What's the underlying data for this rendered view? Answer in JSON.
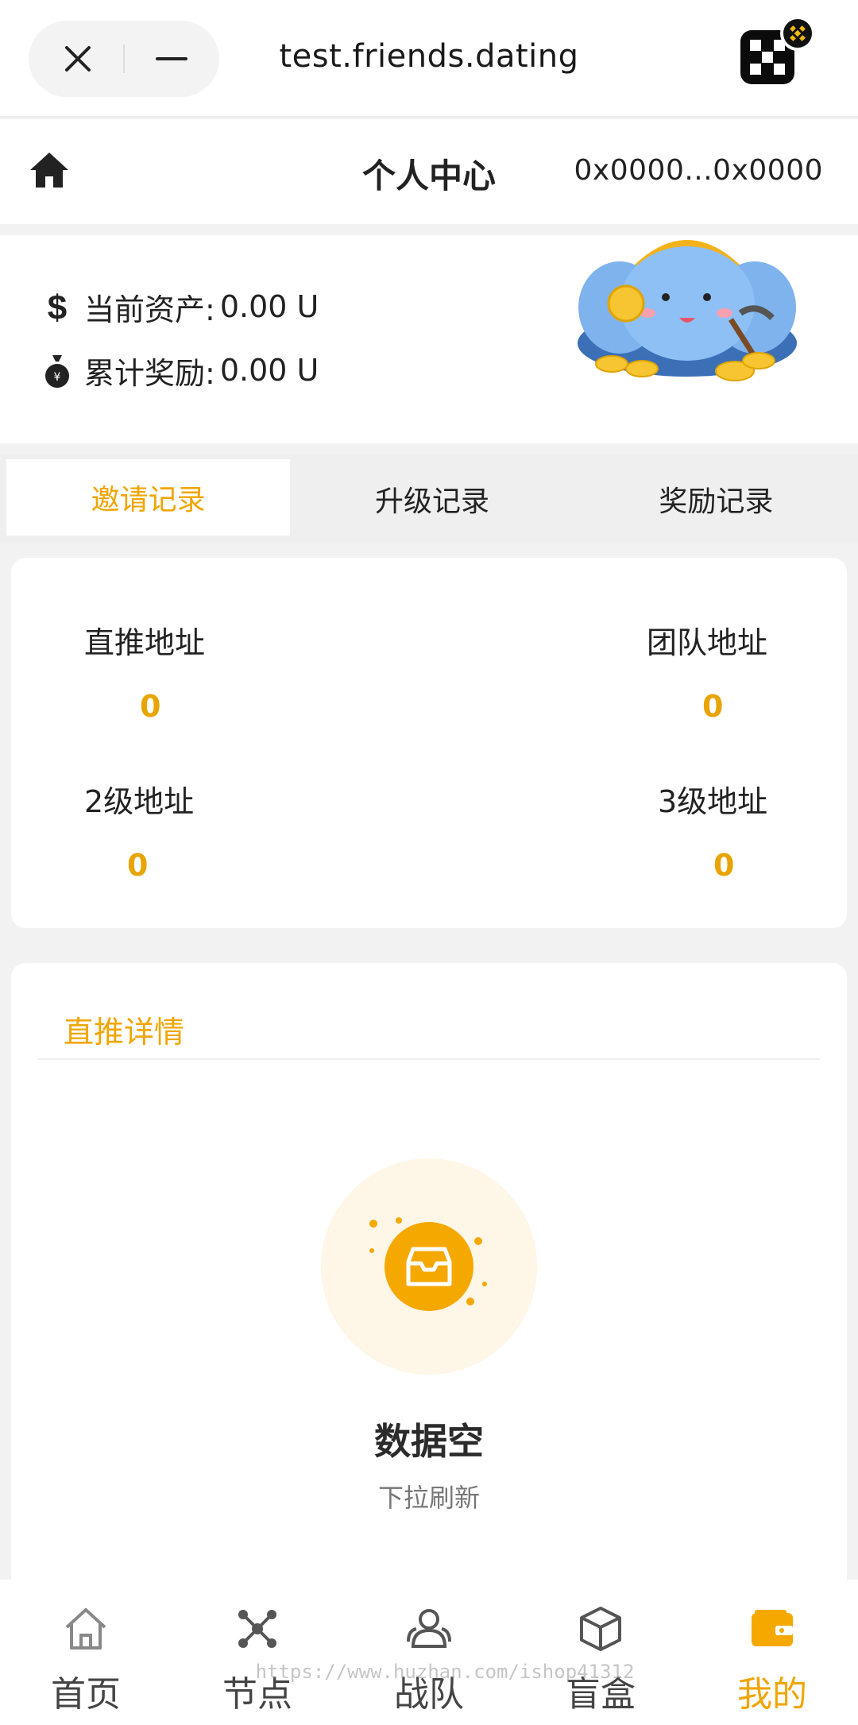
{
  "browser": {
    "url": "test.friends.dating",
    "close_icon": "close-icon",
    "minimize_icon": "minus-icon",
    "app_logo_icon": "okx-logo-icon",
    "badge_icon": "binance-badge-icon"
  },
  "header": {
    "home_icon": "home-icon",
    "title": "个人中心",
    "wallet_address": "0x0000...0x0000"
  },
  "assets": {
    "current_label": "当前资产:",
    "current_value": "0.00 U",
    "reward_label": "累计奖励:",
    "reward_value": "0.00 U"
  },
  "tabs": [
    {
      "label": "邀请记录",
      "active": true
    },
    {
      "label": "升级记录",
      "active": false
    },
    {
      "label": "奖励记录",
      "active": false
    }
  ],
  "stats": {
    "direct": {
      "label": "直推地址",
      "value": "0"
    },
    "team": {
      "label": "团队地址",
      "value": "0"
    },
    "level2": {
      "label": "2级地址",
      "value": "0"
    },
    "level3": {
      "label": "3级地址",
      "value": "0"
    }
  },
  "detail": {
    "title": "直推详情",
    "empty_title": "数据空",
    "empty_subtitle": "下拉刷新"
  },
  "nav": [
    {
      "label": "首页",
      "icon": "home-outline-icon",
      "active": false
    },
    {
      "label": "节点",
      "icon": "network-nodes-icon",
      "active": false
    },
    {
      "label": "战队",
      "icon": "team-icon",
      "active": false
    },
    {
      "label": "盲盒",
      "icon": "box-icon",
      "active": false
    },
    {
      "label": "我的",
      "icon": "wallet-icon",
      "active": true
    }
  ],
  "watermark": "https://www.huzhan.com/ishop41312",
  "colors": {
    "accent": "#f0a500",
    "background": "#f2f2f2",
    "card": "#ffffff"
  }
}
